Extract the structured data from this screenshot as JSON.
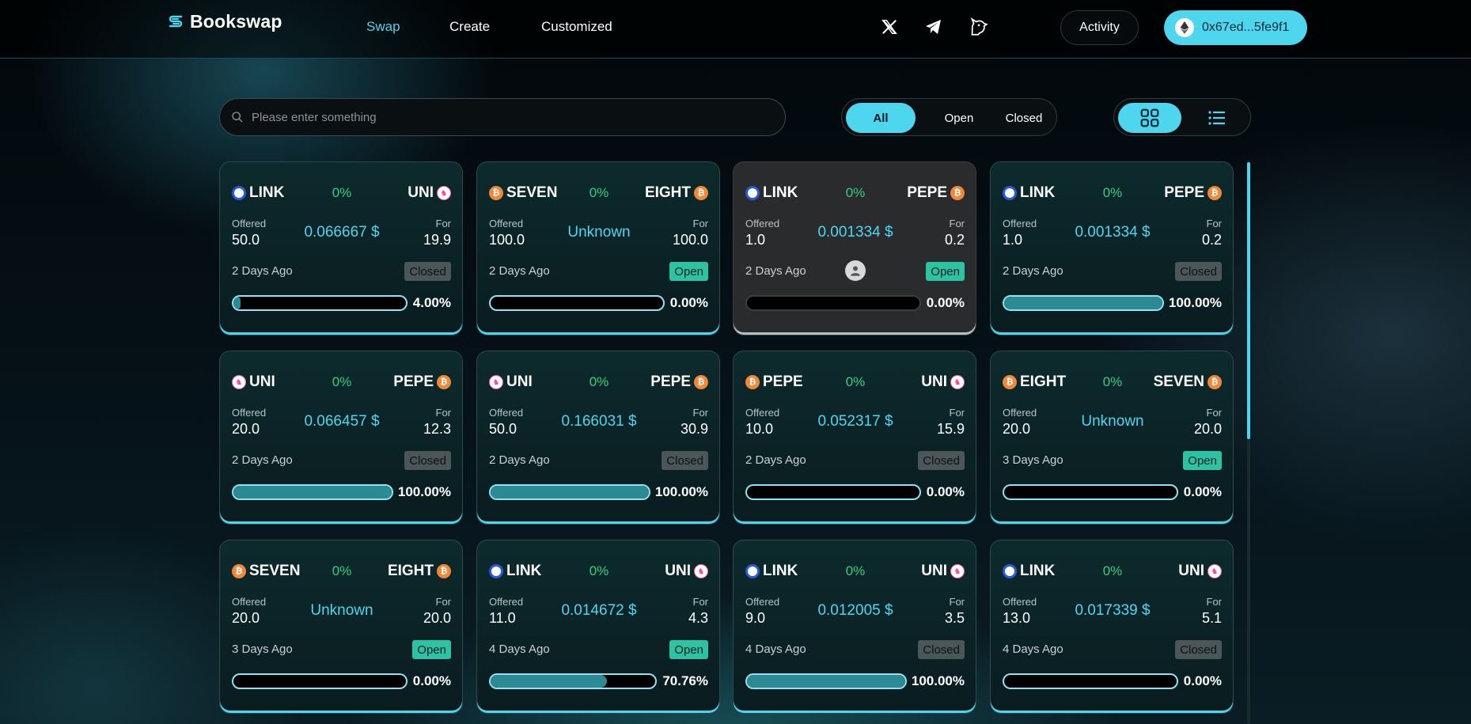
{
  "header": {
    "brand": "Bookswap",
    "nav": [
      {
        "label": "Swap"
      },
      {
        "label": "Create"
      },
      {
        "label": "Customized"
      }
    ],
    "activity_label": "Activity",
    "wallet_label": "0x67ed...5fe9f1",
    "accent_color": "#4fd6ef"
  },
  "search": {
    "placeholder": "Please enter something"
  },
  "filters": {
    "all": "All",
    "open": "Open",
    "closed": "Closed",
    "selected": "All"
  },
  "view_mode": "grid",
  "cards": [
    {
      "from": "LINK",
      "to": "UNI",
      "pct": "0%",
      "offered_label": "Offered",
      "for_label": "For",
      "offered": "50.0",
      "price": "0.066667 $",
      "for": "19.9",
      "ago": "2 Days Ago",
      "status": "Closed",
      "progress": 0.04,
      "progress_text": "4.00%"
    },
    {
      "from": "SEVEN",
      "to": "EIGHT",
      "pct": "0%",
      "offered_label": "Offered",
      "for_label": "For",
      "offered": "100.0",
      "price": "Unknown",
      "for": "100.0",
      "ago": "2 Days Ago",
      "status": "Open",
      "progress": 0,
      "progress_text": "0.00%"
    },
    {
      "from": "LINK",
      "to": "PEPE",
      "pct": "0%",
      "offered_label": "Offered",
      "for_label": "For",
      "offered": "1.0",
      "price": "0.001334 $",
      "for": "0.2",
      "ago": "2 Days Ago",
      "status": "Open",
      "progress": 0,
      "progress_text": "0.00%",
      "mine": true
    },
    {
      "from": "LINK",
      "to": "PEPE",
      "pct": "0%",
      "offered_label": "Offered",
      "for_label": "For",
      "offered": "1.0",
      "price": "0.001334 $",
      "for": "0.2",
      "ago": "2 Days Ago",
      "status": "Closed",
      "progress": 1,
      "progress_text": "100.00%"
    },
    {
      "from": "UNI",
      "to": "PEPE",
      "pct": "0%",
      "offered_label": "Offered",
      "for_label": "For",
      "offered": "20.0",
      "price": "0.066457 $",
      "for": "12.3",
      "ago": "2 Days Ago",
      "status": "Closed",
      "progress": 1,
      "progress_text": "100.00%"
    },
    {
      "from": "UNI",
      "to": "PEPE",
      "pct": "0%",
      "offered_label": "Offered",
      "for_label": "For",
      "offered": "50.0",
      "price": "0.166031 $",
      "for": "30.9",
      "ago": "2 Days Ago",
      "status": "Closed",
      "progress": 1,
      "progress_text": "100.00%"
    },
    {
      "from": "PEPE",
      "to": "UNI",
      "pct": "0%",
      "offered_label": "Offered",
      "for_label": "For",
      "offered": "10.0",
      "price": "0.052317 $",
      "for": "15.9",
      "ago": "2 Days Ago",
      "status": "Closed",
      "progress": 0,
      "progress_text": "0.00%"
    },
    {
      "from": "EIGHT",
      "to": "SEVEN",
      "pct": "0%",
      "offered_label": "Offered",
      "for_label": "For",
      "offered": "20.0",
      "price": "Unknown",
      "for": "20.0",
      "ago": "3 Days Ago",
      "status": "Open",
      "progress": 0,
      "progress_text": "0.00%"
    },
    {
      "from": "SEVEN",
      "to": "EIGHT",
      "pct": "0%",
      "offered_label": "Offered",
      "for_label": "For",
      "offered": "20.0",
      "price": "Unknown",
      "for": "20.0",
      "ago": "3 Days Ago",
      "status": "Open",
      "progress": 0,
      "progress_text": "0.00%"
    },
    {
      "from": "LINK",
      "to": "UNI",
      "pct": "0%",
      "offered_label": "Offered",
      "for_label": "For",
      "offered": "11.0",
      "price": "0.014672 $",
      "for": "4.3",
      "ago": "4 Days Ago",
      "status": "Open",
      "progress": 0.7076,
      "progress_text": "70.76%"
    },
    {
      "from": "LINK",
      "to": "UNI",
      "pct": "0%",
      "offered_label": "Offered",
      "for_label": "For",
      "offered": "9.0",
      "price": "0.012005 $",
      "for": "3.5",
      "ago": "4 Days Ago",
      "status": "Closed",
      "progress": 1,
      "progress_text": "100.00%"
    },
    {
      "from": "LINK",
      "to": "UNI",
      "pct": "0%",
      "offered_label": "Offered",
      "for_label": "For",
      "offered": "13.0",
      "price": "0.017339 $",
      "for": "5.1",
      "ago": "4 Days Ago",
      "status": "Closed",
      "progress": 0,
      "progress_text": "0.00%"
    }
  ]
}
